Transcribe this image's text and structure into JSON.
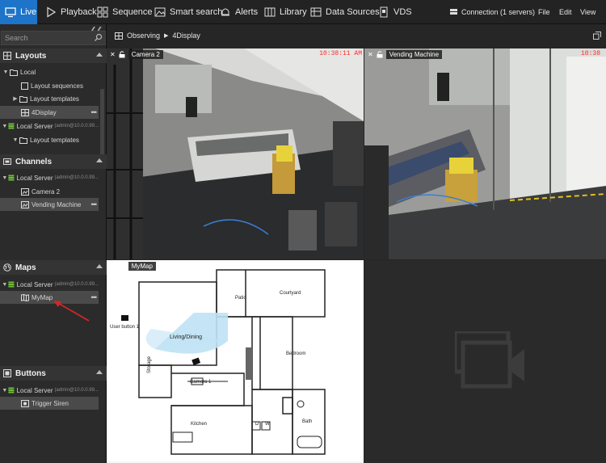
{
  "topbar": {
    "live": "Live",
    "playback": "Playback",
    "sequence": "Sequence",
    "smart_search": "Smart search",
    "alerts": "Alerts",
    "library": "Library",
    "data_sources": "Data Sources",
    "vds": "VDS",
    "connection": "Connection (1 servers)",
    "file": "File",
    "edit": "Edit",
    "view": "View"
  },
  "sidebar": {
    "search_placeholder": "Search",
    "layouts": {
      "title": "Layouts",
      "items": [
        {
          "label": "Local"
        },
        {
          "label": "Layout sequences"
        },
        {
          "label": "Layout templates"
        },
        {
          "label": "4Display"
        },
        {
          "label": "Local Server",
          "sub": "(admin@10.0.0.99..."
        },
        {
          "label": "Layout templates"
        }
      ]
    },
    "channels": {
      "title": "Channels",
      "items": [
        {
          "label": "Local Server",
          "sub": "(admin@10.0.0.99..."
        },
        {
          "label": "Camera 2"
        },
        {
          "label": "Vending Machine"
        }
      ]
    },
    "maps": {
      "title": "Maps",
      "items": [
        {
          "label": "Local Server",
          "sub": "(admin@10.0.0.99..."
        },
        {
          "label": "MyMap"
        }
      ]
    },
    "buttons": {
      "title": "Buttons",
      "items": [
        {
          "label": "Local Server",
          "sub": "(admin@10.0.0.99..."
        },
        {
          "label": "Trigger Siren"
        }
      ]
    }
  },
  "breadcrumb": {
    "root": "Observing",
    "current": "4Display"
  },
  "tiles": {
    "cam1": {
      "title": "Camera 2",
      "timestamp": "10:38:11 AM"
    },
    "cam2": {
      "title": "Vending Machine",
      "timestamp": "10:38"
    },
    "map": {
      "title": "MyMap",
      "labels": {
        "patio": "Patio",
        "courtyard": "Courtyard",
        "living": "Living/Dining",
        "bedroom": "Bedroom",
        "storage": "Storage",
        "camera1": "Camera 1",
        "kitchen": "Kitchen",
        "bath": "Bath",
        "user_button": "User button 1",
        "dryer": "D",
        "washer": "W"
      }
    }
  },
  "colors": {
    "accent": "#1d74c8",
    "timestamp": "#ff2a2a",
    "server_icon": "#6fbf3a",
    "annotation_arrow": "#d02828"
  }
}
